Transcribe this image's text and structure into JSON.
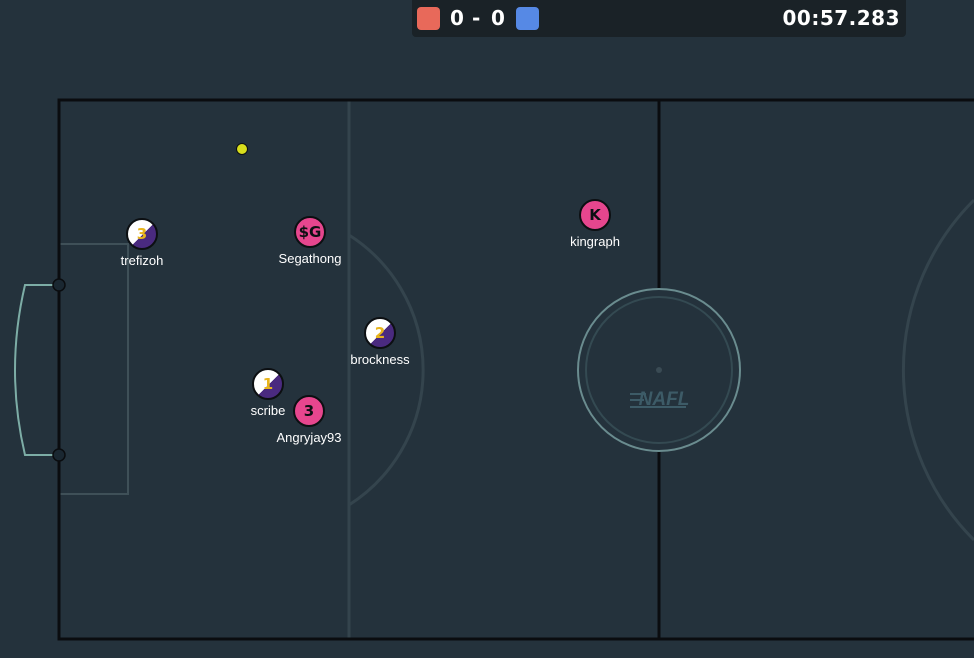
{
  "scoreboard": {
    "red_color": "#e8695a",
    "blue_color": "#5689e5",
    "red_score": "0",
    "separator": "-",
    "blue_score": "0",
    "time": "00:57.283"
  },
  "field": {
    "logo_text": "NAFL"
  },
  "players": [
    {
      "name": "trefizoh",
      "avatar": "3",
      "team": "blue"
    },
    {
      "name": "Segathong",
      "avatar": "$G",
      "team": "red"
    },
    {
      "name": "kingraph",
      "avatar": "K",
      "team": "red"
    },
    {
      "name": "brockness",
      "avatar": "2",
      "team": "blue"
    },
    {
      "name": "scribe",
      "avatar": "1",
      "team": "blue"
    },
    {
      "name": "Angryjay93",
      "avatar": "3",
      "team": "red"
    }
  ],
  "ball": {
    "color": "#d8de1c"
  }
}
